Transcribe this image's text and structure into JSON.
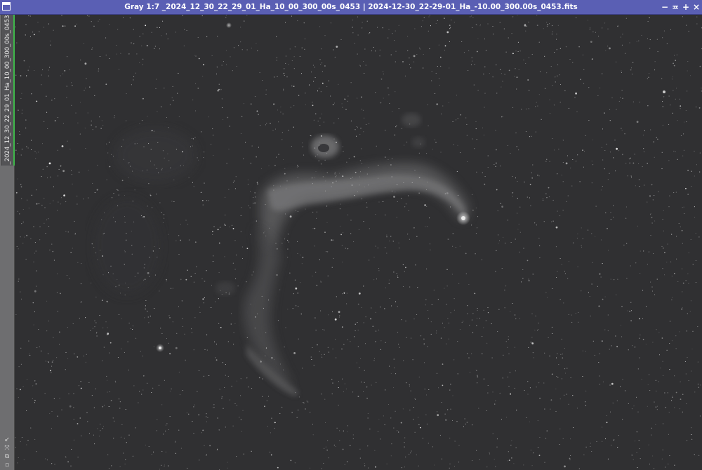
{
  "window": {
    "title": "Gray 1:7 _2024_12_30_22_29_01_Ha_10_00_300_00s_0453 | 2024-12-30_22-29-01_Ha_-10.00_300.00s_0453.fits",
    "buttons": {
      "minimize": "−",
      "shade": "≖",
      "maximize": "+",
      "close": "×"
    },
    "accent_color": "#5a5fb4"
  },
  "side_tab": {
    "label": "_2024_12_30_22_29_01_Ha_10_00_300_00s_0453",
    "active_color": "#3fb84a"
  },
  "side_icons": [
    "pin-icon",
    "expand-icon",
    "copy-icon",
    "lock-icon"
  ],
  "image": {
    "description_icon": "astronomical-image",
    "zoom": "1:7",
    "color_mode": "Gray"
  }
}
